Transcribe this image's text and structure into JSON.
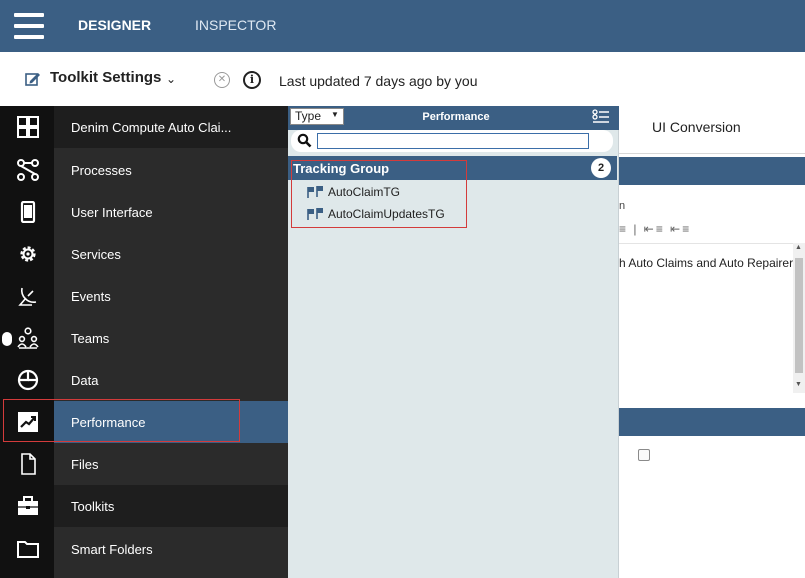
{
  "colors": {
    "brand": "#3b5f84",
    "sidebar_dark": "#111111",
    "sidebar_label_bg": "#2b2b2b",
    "flyout_bg": "#dfe8ea",
    "highlight": "#d33b3b"
  },
  "topbar": {
    "tabs": [
      "DESIGNER",
      "INSPECTOR"
    ],
    "active_tab": "DESIGNER"
  },
  "settings_bar": {
    "title": "Toolkit Settings",
    "last_updated": "Last updated 7 days ago by you"
  },
  "sidebar": {
    "items": [
      {
        "label": "Denim Compute Auto Clai...",
        "icon": "dashboard-icon"
      },
      {
        "label": "Processes",
        "icon": "process-flow-icon"
      },
      {
        "label": "User Interface",
        "icon": "mobile-device-icon"
      },
      {
        "label": "Services",
        "icon": "gear-icon"
      },
      {
        "label": "Events",
        "icon": "satellite-dish-icon"
      },
      {
        "label": "Teams",
        "icon": "team-icon"
      },
      {
        "label": "Data",
        "icon": "pie-chart-icon"
      },
      {
        "label": "Performance",
        "icon": "trend-chart-icon"
      },
      {
        "label": "Files",
        "icon": "file-icon"
      },
      {
        "label": "Toolkits",
        "icon": "toolbox-icon"
      },
      {
        "label": "Smart Folders",
        "icon": "folder-icon"
      }
    ],
    "selected": "Performance"
  },
  "flyout": {
    "type_select": "Type",
    "title": "Performance",
    "search": {
      "value": "",
      "placeholder": ""
    },
    "group": {
      "label": "Tracking Group",
      "count": "2",
      "items": [
        "AutoClaimTG",
        "AutoClaimUpdatesTG"
      ]
    }
  },
  "right_panel": {
    "tab_label": "UI Conversion",
    "fragment_label": "n",
    "editor_text": "h Auto Claims and Auto Repairers"
  }
}
